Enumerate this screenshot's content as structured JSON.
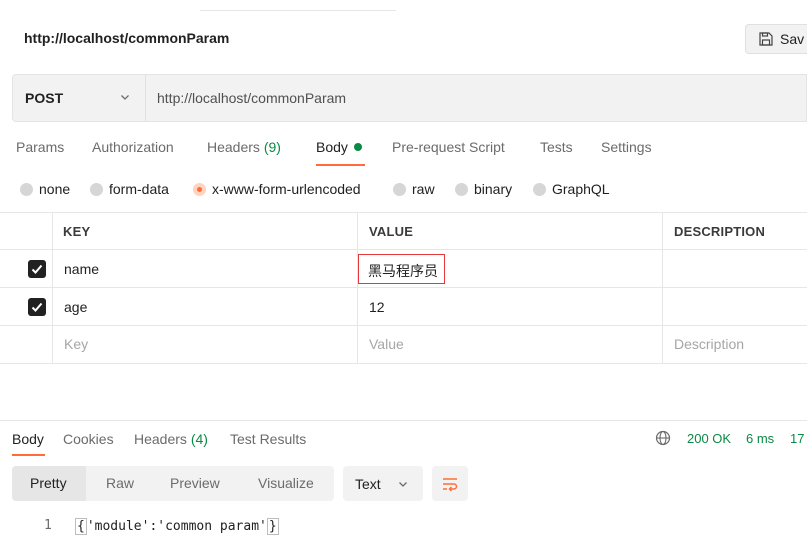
{
  "request": {
    "title": "http://localhost/commonParam",
    "save_label": "Sav",
    "method": "POST",
    "url": "http://localhost/commonParam"
  },
  "tabs": [
    {
      "label": "Params"
    },
    {
      "label": "Authorization"
    },
    {
      "label": "Headers",
      "count": "(9)"
    },
    {
      "label": "Body",
      "active": true
    },
    {
      "label": "Pre-request Script"
    },
    {
      "label": "Tests"
    },
    {
      "label": "Settings"
    }
  ],
  "body_types": [
    {
      "label": "none"
    },
    {
      "label": "form-data"
    },
    {
      "label": "x-www-form-urlencoded",
      "selected": true
    },
    {
      "label": "raw"
    },
    {
      "label": "binary"
    },
    {
      "label": "GraphQL"
    }
  ],
  "table": {
    "headers": [
      "KEY",
      "VALUE",
      "DESCRIPTION"
    ],
    "rows": [
      {
        "checked": true,
        "key": "name",
        "value": "黑马程序员",
        "description": ""
      },
      {
        "checked": true,
        "key": "age",
        "value": "12",
        "description": ""
      }
    ],
    "placeholder": {
      "key": "Key",
      "value": "Value",
      "description": "Description"
    }
  },
  "response": {
    "tabs": [
      {
        "label": "Body",
        "active": true
      },
      {
        "label": "Cookies"
      },
      {
        "label": "Headers",
        "count": "(4)"
      },
      {
        "label": "Test Results"
      }
    ],
    "status": "200 OK",
    "time": "6 ms",
    "size": "17",
    "views": [
      "Pretty",
      "Raw",
      "Preview",
      "Visualize"
    ],
    "active_view": "Pretty",
    "format": "Text",
    "code": {
      "line_number": "1",
      "open_brace": "{",
      "text": "'module':'common param'",
      "close_brace": "}"
    }
  },
  "colors": {
    "accent": "#ff6c37",
    "success": "#0b8a45",
    "highlight_border": "#e5383b"
  }
}
